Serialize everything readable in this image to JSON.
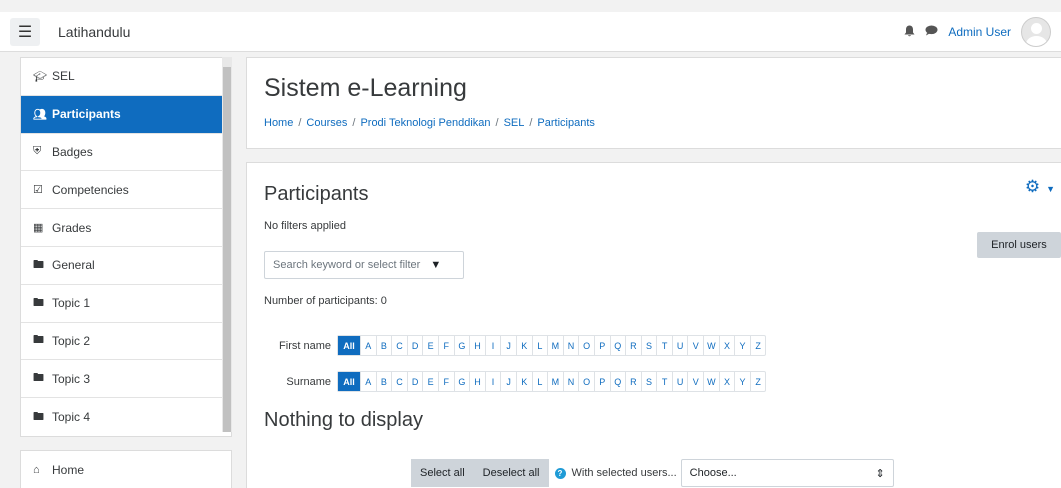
{
  "navbar": {
    "menu_icon": "hamburger-icon",
    "site_name": "Latihandulu",
    "bell_icon": "bell-icon",
    "message_icon": "comment-icon",
    "user_name": "Admin User"
  },
  "drawer": {
    "items": [
      {
        "label": "SEL",
        "icon": "graduation-cap-icon",
        "active": false
      },
      {
        "label": "Participants",
        "icon": "users-icon",
        "active": true
      },
      {
        "label": "Badges",
        "icon": "shield-icon",
        "active": false
      },
      {
        "label": "Competencies",
        "icon": "check-square-icon",
        "active": false
      },
      {
        "label": "Grades",
        "icon": "table-icon",
        "active": false
      },
      {
        "label": "General",
        "icon": "folder-icon",
        "active": false
      },
      {
        "label": "Topic 1",
        "icon": "folder-icon",
        "active": false
      },
      {
        "label": "Topic 2",
        "icon": "folder-icon",
        "active": false
      },
      {
        "label": "Topic 3",
        "icon": "folder-icon",
        "active": false
      },
      {
        "label": "Topic 4",
        "icon": "folder-icon",
        "active": false
      }
    ],
    "secondary": [
      {
        "label": "Home",
        "icon": "home-icon"
      }
    ]
  },
  "header": {
    "title": "Sistem e-Learning",
    "breadcrumb": [
      "Home",
      "Courses",
      "Prodi Teknologi Penddikan",
      "SEL",
      "Participants"
    ]
  },
  "main": {
    "heading": "Participants",
    "filters_text": "No filters applied",
    "enrol_button": "Enrol users",
    "search_placeholder": "Search keyword or select filter",
    "count_text": "Number of participants: 0",
    "firstname_label": "First name",
    "surname_label": "Surname",
    "all_label": "All",
    "letters": [
      "A",
      "B",
      "C",
      "D",
      "E",
      "F",
      "G",
      "H",
      "I",
      "J",
      "K",
      "L",
      "M",
      "N",
      "O",
      "P",
      "Q",
      "R",
      "S",
      "T",
      "U",
      "V",
      "W",
      "X",
      "Y",
      "Z"
    ],
    "empty_text": "Nothing to display",
    "select_all": "Select all",
    "deselect_all": "Deselect all",
    "with_selected": "With selected users...",
    "choose": "Choose..."
  },
  "colors": {
    "accent": "#0f6cbf",
    "background": "#f2f2f2"
  }
}
